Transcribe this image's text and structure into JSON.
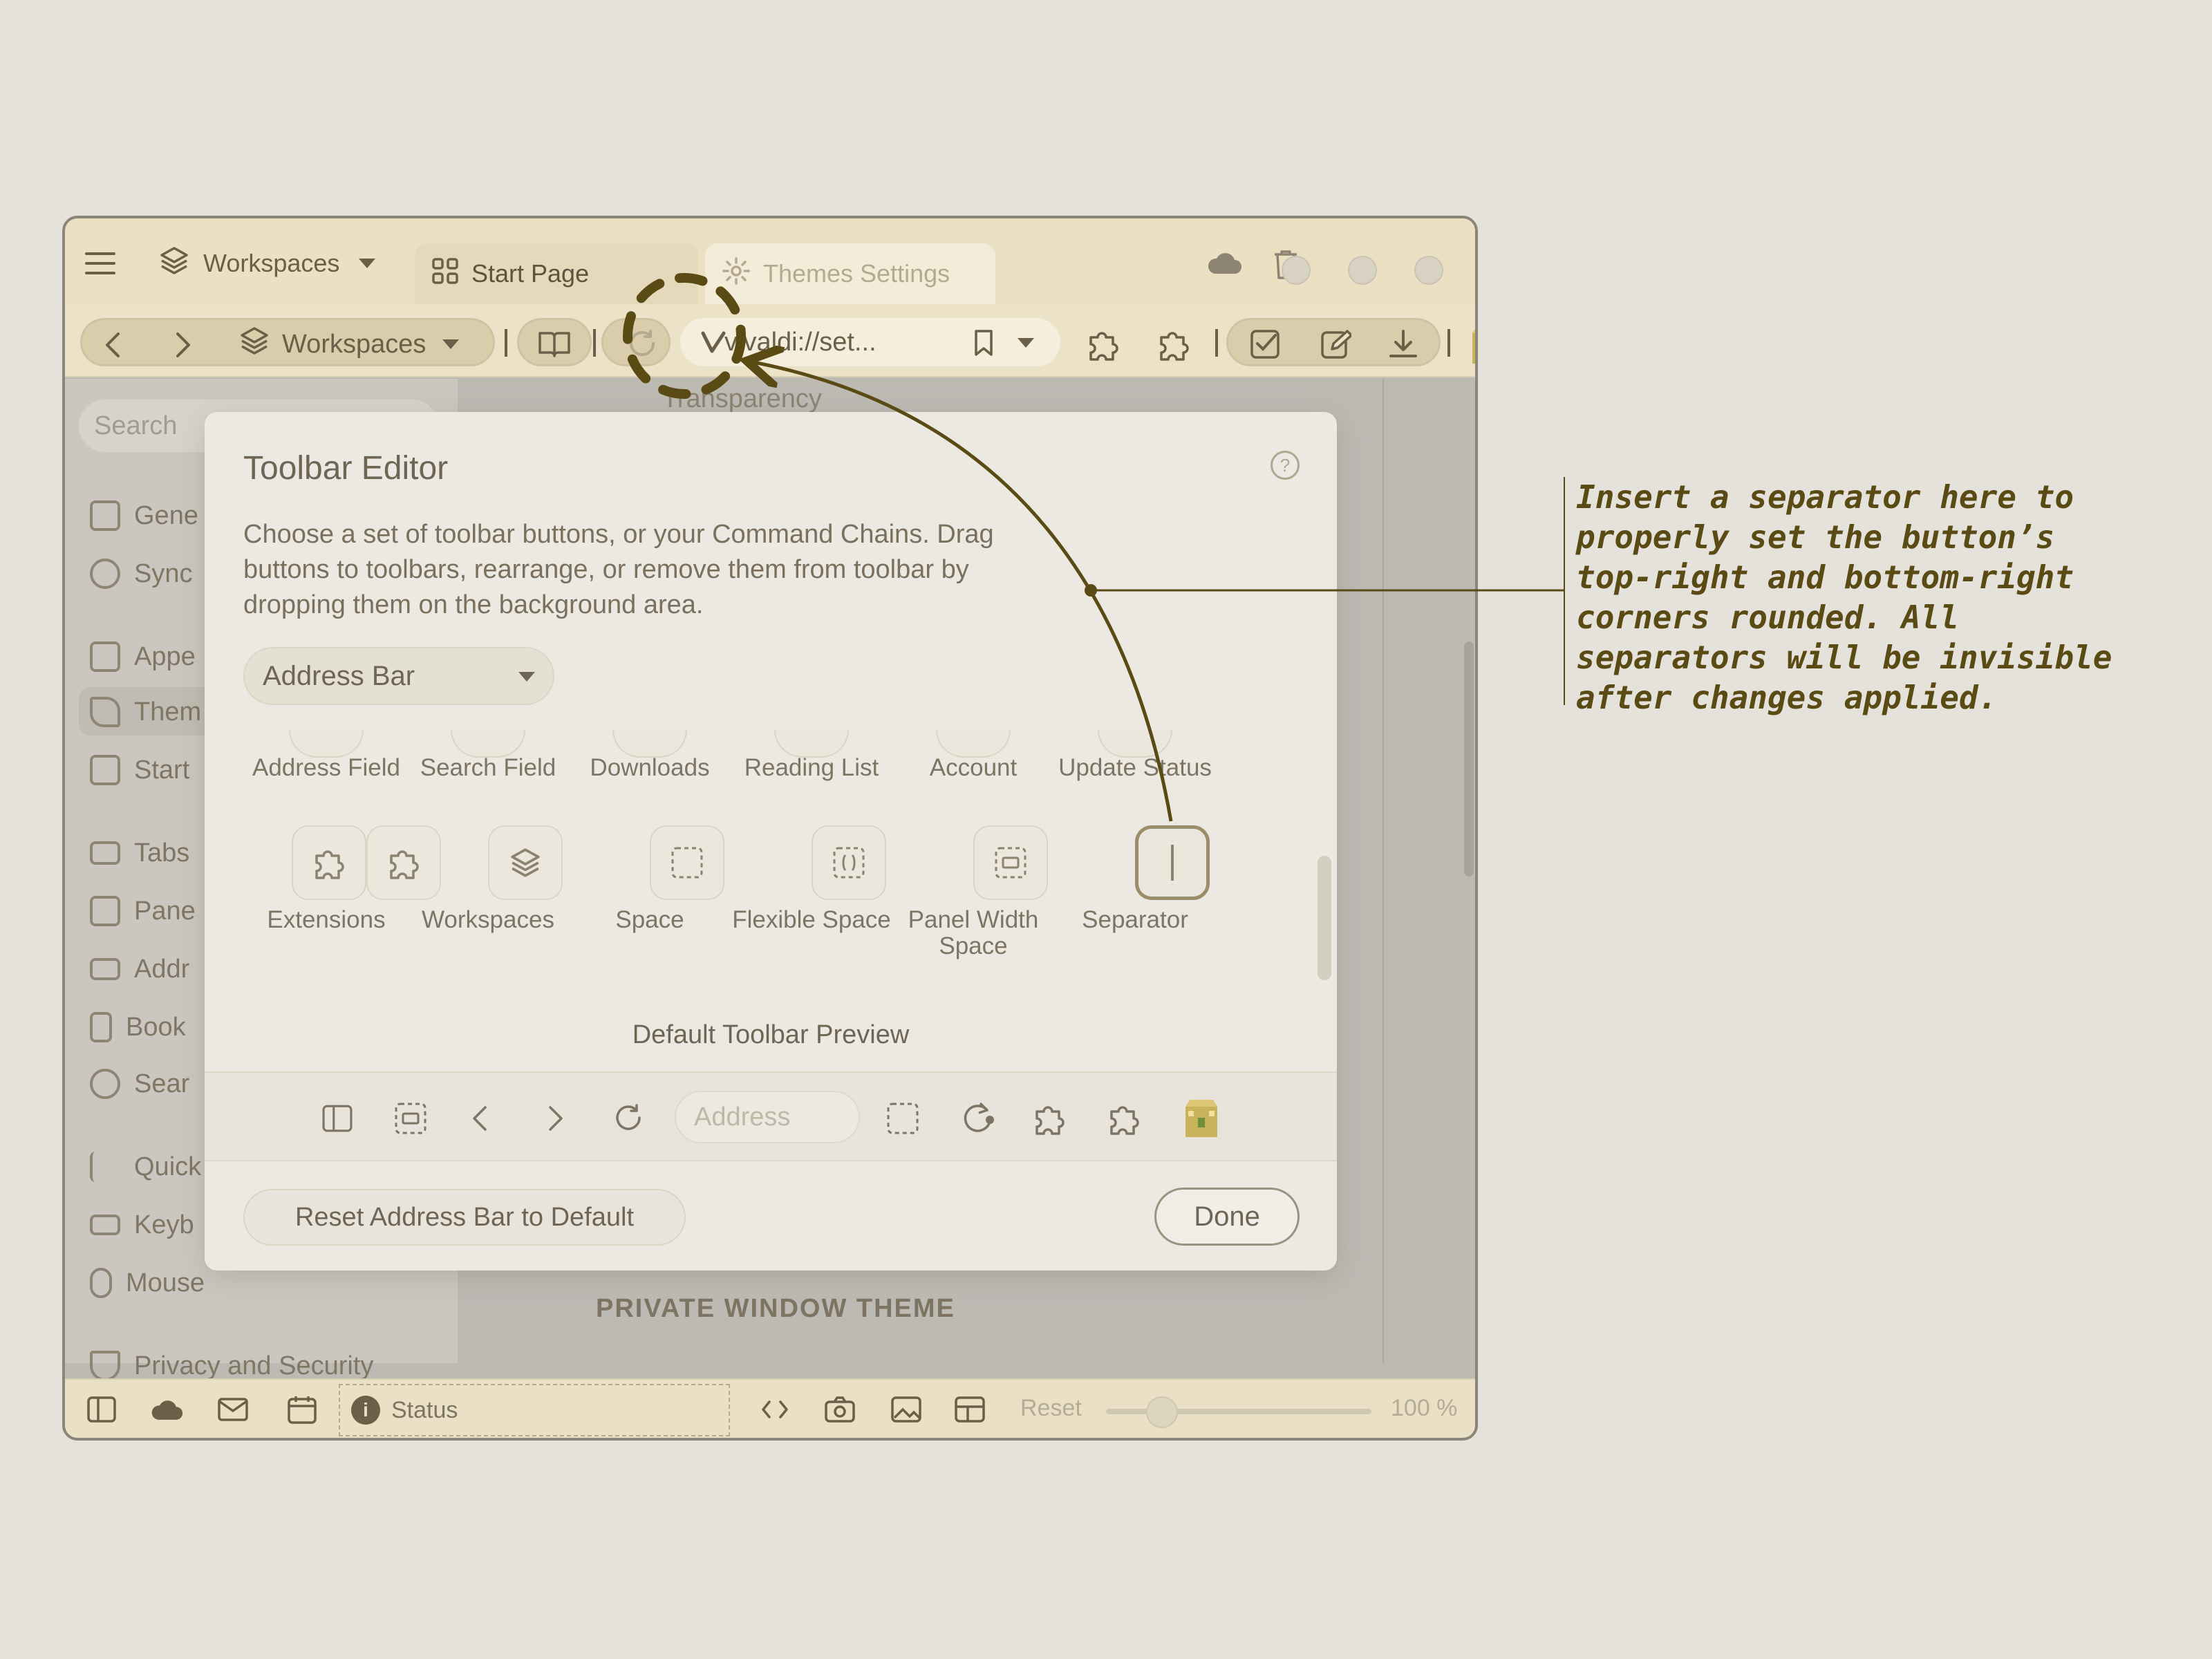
{
  "browser": {
    "titlebar": {
      "workspaces_label": "Workspaces",
      "tabs": [
        {
          "label": "Start Page"
        },
        {
          "label": "Themes Settings"
        }
      ]
    },
    "navbar": {
      "workspaces_label": "Workspaces",
      "url_text": "vivaldi://set..."
    },
    "sidebar": {
      "search_placeholder": "Search",
      "items": [
        {
          "label": "Gene"
        },
        {
          "label": "Sync"
        },
        {
          "label": "Appe"
        },
        {
          "label": "Them"
        },
        {
          "label": "Start"
        },
        {
          "label": "Tabs"
        },
        {
          "label": "Pane"
        },
        {
          "label": "Addr"
        },
        {
          "label": "Book"
        },
        {
          "label": "Sear"
        },
        {
          "label": "Quick"
        },
        {
          "label": "Keyb"
        },
        {
          "label": "Mouse"
        },
        {
          "label": "Privacy and Security"
        }
      ]
    },
    "content": {
      "transparency_label": "Transparency",
      "private_window_theme": "PRIVATE WINDOW THEME"
    },
    "statusbar": {
      "status_label": "Status",
      "reset_label": "Reset",
      "zoom_label": "100 %",
      "zoom_level": 1.0
    }
  },
  "dialog": {
    "title": "Toolbar Editor",
    "help": "?",
    "description": "Choose a set of toolbar buttons, or your Command Chains. Drag buttons to toolbars, rearrange, or remove them from toolbar by dropping them on the background area.",
    "select_value": "Address Bar",
    "items_row1": [
      {
        "label": "Address Field"
      },
      {
        "label": "Search Field"
      },
      {
        "label": "Downloads"
      },
      {
        "label": "Reading List"
      },
      {
        "label": "Account"
      },
      {
        "label": "Update Status"
      }
    ],
    "items_row2": [
      {
        "label": "Extensions"
      },
      {
        "label": "Workspaces"
      },
      {
        "label": "Space"
      },
      {
        "label": "Flexible Space"
      },
      {
        "label": "Panel Width Space"
      },
      {
        "label": "Separator"
      }
    ],
    "preview_title": "Default Toolbar Preview",
    "preview_address_placeholder": "Address",
    "reset_button": "Reset Address Bar to Default",
    "done_button": "Done"
  },
  "annotation": {
    "text": "Insert a separator here to\nproperly set the button’s\ntop-right and bottom-right\ncorners rounded. All\nseparators will be invisible\nafter changes applied."
  },
  "colors": {
    "background": "#e5e2db",
    "accent": "#5a4a14",
    "chrome": "#ebe0c2"
  }
}
